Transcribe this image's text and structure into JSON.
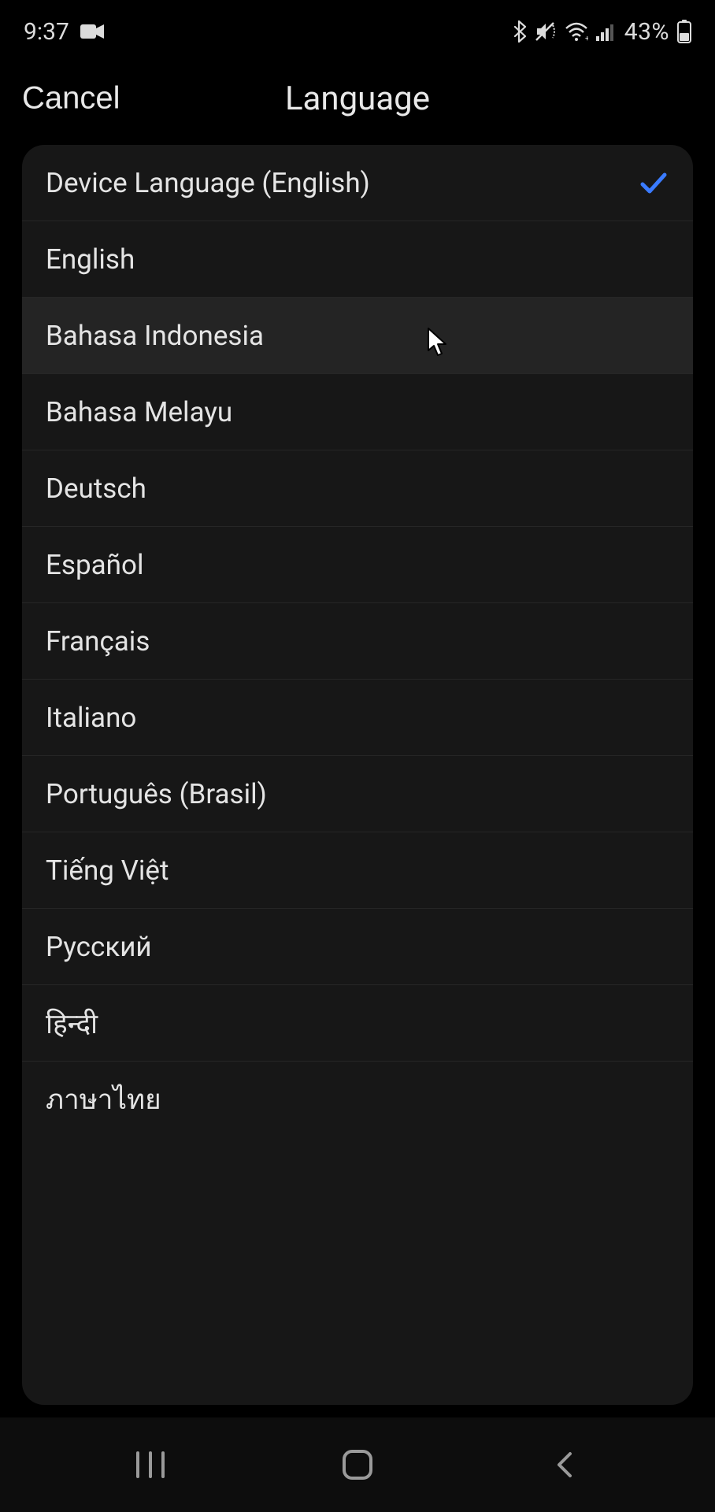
{
  "status": {
    "time": "9:37",
    "battery_pct": "43%"
  },
  "header": {
    "cancel_label": "Cancel",
    "title": "Language"
  },
  "languages": [
    {
      "label": "Device Language (English)",
      "selected": true,
      "hover": false
    },
    {
      "label": "English",
      "selected": false,
      "hover": false
    },
    {
      "label": "Bahasa Indonesia",
      "selected": false,
      "hover": true
    },
    {
      "label": "Bahasa Melayu",
      "selected": false,
      "hover": false
    },
    {
      "label": "Deutsch",
      "selected": false,
      "hover": false
    },
    {
      "label": "Español",
      "selected": false,
      "hover": false
    },
    {
      "label": "Français",
      "selected": false,
      "hover": false
    },
    {
      "label": "Italiano",
      "selected": false,
      "hover": false
    },
    {
      "label": "Português (Brasil)",
      "selected": false,
      "hover": false
    },
    {
      "label": "Tiếng Việt",
      "selected": false,
      "hover": false
    },
    {
      "label": "Русский",
      "selected": false,
      "hover": false
    },
    {
      "label": "हिन्दी",
      "selected": false,
      "hover": false
    },
    {
      "label": "ภาษาไทย",
      "selected": false,
      "hover": false
    }
  ],
  "colors": {
    "check": "#3a7bff"
  }
}
